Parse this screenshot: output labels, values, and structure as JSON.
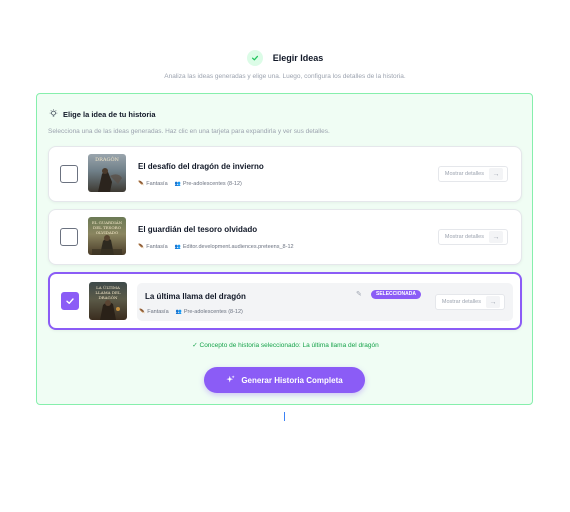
{
  "header": {
    "title": "Elegir Ideas",
    "subtitle": "Analiza las ideas generadas y elige una. Luego, configura los detalles de la historia."
  },
  "panel": {
    "title": "Elige la idea de tu historia",
    "description": "Selecciona una de las ideas generadas. Haz clic en una tarjeta para expandirla y ver sus detalles."
  },
  "ideas": [
    {
      "title": "El desafío del dragón de invierno",
      "genre": "Fantasía",
      "audience": "Pre-adolescentes (8-12)",
      "cover_title": "DRAGÓN",
      "selected": false,
      "details_label": "Mostrar detalles"
    },
    {
      "title": "El guardián del tesoro olvidado",
      "genre": "Fantasía",
      "audience": "Editor.development.audiences.preteens_8-12",
      "cover_title": "EL GUARDIÁN DEL TESORO OLVIDADO",
      "selected": false,
      "details_label": "Mostrar detalles"
    },
    {
      "title": "La última llama del dragón",
      "genre": "Fantasía",
      "audience": "Pre-adolescentes (8-12)",
      "cover_title": "LA ÚLTIMA LLAMA DEL DRAGÓN",
      "selected": true,
      "badge": "SELECCIONADA",
      "details_label": "Mostrar detalles"
    }
  ],
  "confirmation": "✓ Concepto de historia seleccionado: La última llama del dragón",
  "generate_button": "Generar Historia Completa",
  "colors": {
    "accent": "#8b5cf6",
    "success": "#16a34a",
    "panel_bg": "#f0fdf4"
  }
}
